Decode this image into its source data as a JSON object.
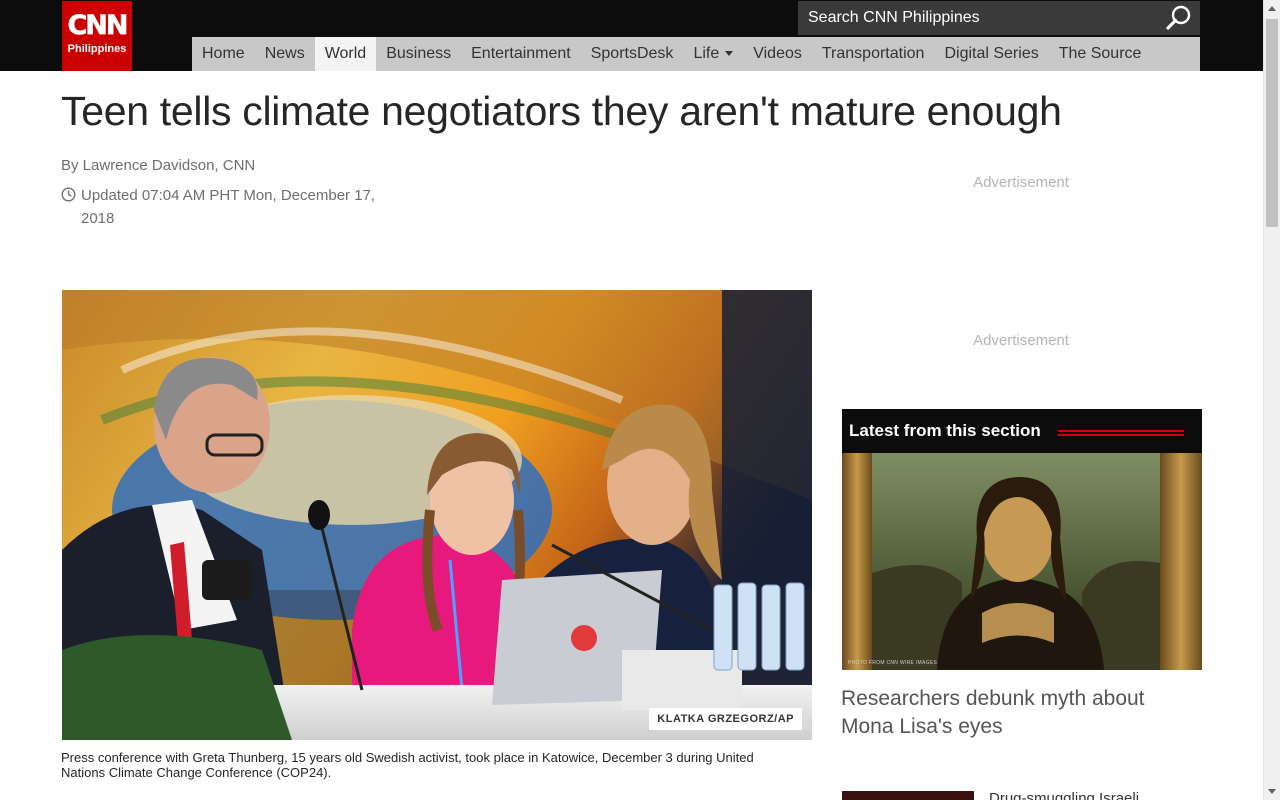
{
  "header": {
    "logo_text": "CNN",
    "edition": "Philippines",
    "search_placeholder": "Search CNN Philippines",
    "nav": [
      {
        "label": "Home"
      },
      {
        "label": "News"
      },
      {
        "label": "World",
        "active": true
      },
      {
        "label": "Business"
      },
      {
        "label": "Entertainment"
      },
      {
        "label": "SportsDesk"
      },
      {
        "label": "Life",
        "dropdown": true
      },
      {
        "label": "Videos"
      },
      {
        "label": "Transportation"
      },
      {
        "label": "Digital Series"
      },
      {
        "label": "The Source"
      }
    ]
  },
  "article": {
    "headline": "Teen tells climate negotiators they aren't mature enough",
    "byline": "By Lawrence Davidson, CNN",
    "updated": "Updated 07:04 AM PHT Mon, December 17, 2018",
    "photo_credit": "KLATKA GRZEGORZ/AP",
    "caption": "Press conference with Greta Thunberg, 15 years old Swedish activist, took place in Katowice, December 3 during United Nations Climate Change Conference (COP24)."
  },
  "sidebar": {
    "ad1": "Advertisement",
    "ad2": "Advertisement",
    "latest_title": "Latest from this section",
    "latest_img_credit": "PHOTO FROM CNN WIRE IMAGES",
    "latest_headline": "Researchers debunk myth about Mona Lisa's eyes",
    "next_headline": "Drug-smuggling Israeli"
  },
  "colors": {
    "brand_red": "#cc0000",
    "header_black": "#0c0c0c",
    "nav_gray": "#c8c8c8"
  },
  "icons": {
    "search": "magnifier-icon",
    "updated": "clock-icon"
  }
}
